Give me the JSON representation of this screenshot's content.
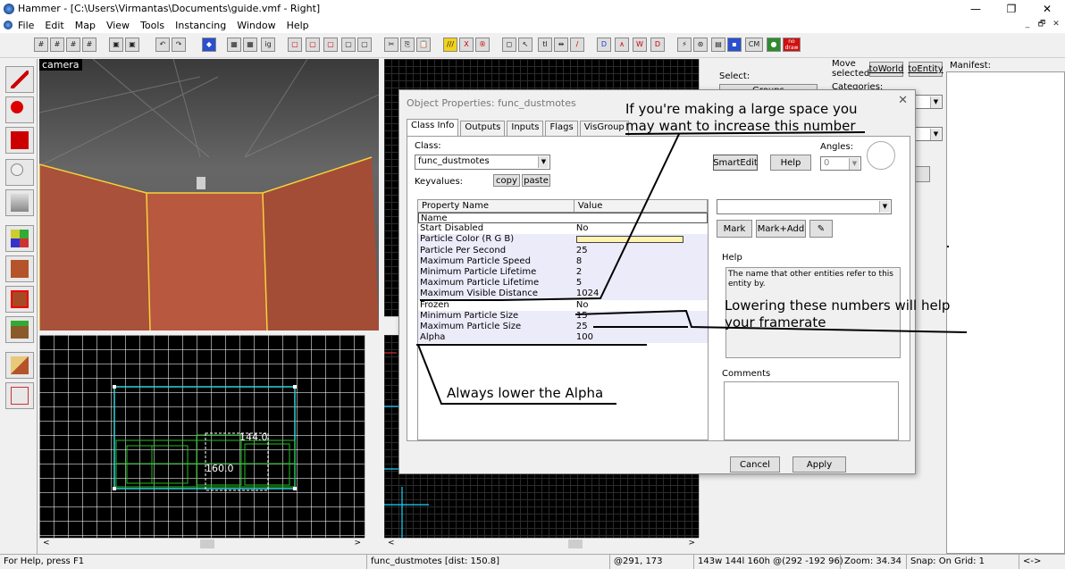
{
  "window": {
    "title": "Hammer - [C:\\Users\\Virmantas\\Documents\\guide.vmf - Right]",
    "min": "—",
    "max": "❐",
    "close": "✕"
  },
  "menu": [
    "File",
    "Edit",
    "Map",
    "View",
    "Tools",
    "Instancing",
    "Window",
    "Help"
  ],
  "mdi": {
    "min": "_",
    "restore": "🗗",
    "close": "✕"
  },
  "toolbar_text": {
    "ig": "ig",
    "tl": "tl",
    "cm": "CM",
    "nodraw": "no draw"
  },
  "viewports": {
    "camera_label": "camera",
    "dim_a": "144.0",
    "dim_b": "160.0"
  },
  "right_panel": {
    "move_selected": "Move selected:",
    "to_world": "toWorld",
    "to_entity": "toEntity",
    "manifest": "Manifest:",
    "select": "Select:",
    "groups": "Groups",
    "categories": "Categories:"
  },
  "dialog": {
    "title": "Object Properties: func_dustmotes",
    "close": "✕",
    "tabs": [
      "Class Info",
      "Outputs",
      "Inputs",
      "Flags",
      "VisGroup"
    ],
    "class_label": "Class:",
    "class_value": "func_dustmotes",
    "keyvalues_label": "Keyvalues:",
    "copy": "copy",
    "paste": "paste",
    "smartedit": "SmartEdit",
    "help_btn": "Help",
    "angles_label": "Angles:",
    "angles_value": "0",
    "mark": "Mark",
    "markadd": "Mark+Add",
    "help_label": "Help",
    "help_text": "The name that other entities refer to this entity by.",
    "comments_label": "Comments",
    "cancel": "Cancel",
    "apply": "Apply",
    "col_property": "Property Name",
    "col_value": "Value",
    "color_swatch": "#fff3b0",
    "rows": [
      {
        "k": "Name",
        "v": ""
      },
      {
        "k": "Start Disabled",
        "v": "No"
      },
      {
        "k": "Particle Color (R G B)",
        "v": ""
      },
      {
        "k": "Particle Per Second",
        "v": "25"
      },
      {
        "k": "Maximum Particle Speed",
        "v": "8"
      },
      {
        "k": "Minimum Particle Lifetime",
        "v": "2"
      },
      {
        "k": "Maximum Particle Lifetime",
        "v": "5"
      },
      {
        "k": "Maximum Visible Distance",
        "v": "1024"
      },
      {
        "k": "Frozen",
        "v": "No"
      },
      {
        "k": "Minimum Particle Size",
        "v": "15"
      },
      {
        "k": "Maximum Particle Size",
        "v": "25"
      },
      {
        "k": "Alpha",
        "v": "100"
      }
    ]
  },
  "annotations": {
    "a1_line1": "If you're making a large space you",
    "a1_line2": "may want to increase this number",
    "a2_line1": "Lowering these numbers will help",
    "a2_line2": "your framerate",
    "a3": "Always lower the Alpha"
  },
  "status": {
    "help": "For Help, press F1",
    "selection": "func_dustmotes  [dist: 150.8]",
    "coords": "@291, 173",
    "size": "143w 144l 160h @(292 -192 96)",
    "zoom": "Zoom: 34.34",
    "snap": "Snap: On Grid: 1",
    "arrows": "<->"
  }
}
